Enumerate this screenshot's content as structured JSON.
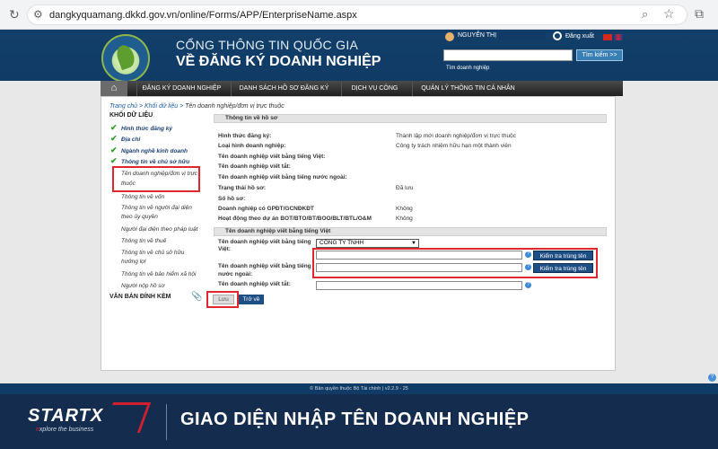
{
  "browser": {
    "url": "dangkyquamang.dkkd.gov.vn/online/Forms/APP/EnterpriseName.aspx"
  },
  "header": {
    "title_line1": "CỔNG THÔNG TIN QUỐC GIA",
    "title_line2": "VỀ ĐĂNG KÝ DOANH NGHIỆP",
    "user_name": "NGUYỄN THỊ",
    "logout_label": "Đăng xuất",
    "search_button": "Tìm kiếm >>",
    "search_hint": "Tìm doanh nghiệp"
  },
  "nav": {
    "items": [
      "ĐĂNG KÝ DOANH NGHIỆP",
      "DANH SÁCH HỒ SƠ ĐĂNG KÝ",
      "DỊCH VỤ CÔNG",
      "QUẢN LÝ THÔNG TIN CÁ NHÂN"
    ]
  },
  "breadcrumb": {
    "home": "Trang chủ",
    "section": "Khối dữ liệu",
    "current": "Tên doanh nghiệp/đơn vị trực thuộc"
  },
  "sidebar": {
    "title": "KHỐI DỮ LIỆU",
    "checked_items": [
      "Hình thức đăng ký",
      "Địa chỉ",
      "Ngành nghề kinh doanh",
      "Thông tin về chủ sở hữu"
    ],
    "active_item_line1": "Tên doanh nghiệp/đơn vị trực",
    "active_item_line2": "thuộc",
    "items": [
      "Thông tin về vốn",
      "Thông tin về người đại diện theo ủy quyền",
      "Người đại diện theo pháp luật",
      "Thông tin về thuế",
      "Thông tin về chủ sở hữu hưởng lợi",
      "Thông tin về bảo hiểm xã hội",
      "Người nộp hồ sơ"
    ],
    "attachments": "VĂN BẢN ĐÍNH KÈM"
  },
  "profile": {
    "header": "Thông tin về hồ sơ",
    "rows": [
      {
        "label": "Hình thức đăng ký:",
        "value": "Thành lập mới doanh nghiệp/đơn vị trực thuộc"
      },
      {
        "label": "Loại hình doanh nghiệp:",
        "value": "Công ty trách nhiệm hữu hạn một thành viên"
      },
      {
        "label": "Tên doanh nghiệp viết bằng tiếng Việt:",
        "value": ""
      },
      {
        "label": "Tên doanh nghiệp viết tắt:",
        "value": ""
      },
      {
        "label": "Tên doanh nghiệp viết bằng tiếng nước ngoài:",
        "value": ""
      },
      {
        "label": "Trạng thái hồ sơ:",
        "value": "Đã lưu"
      },
      {
        "label": "Số hồ sơ:",
        "value": ""
      },
      {
        "label": "Doanh nghiệp có GPĐT/GCNĐKĐT",
        "value": "Không"
      },
      {
        "label": "Hoạt động theo dự án BOT/BTO/BT/BOO/BLT/BTL/O&M",
        "value": "Không"
      }
    ]
  },
  "name_form": {
    "header": "Tên doanh nghiệp viết bằng tiếng Việt",
    "vn_label_line1": "Tên doanh nghiệp viết bằng tiếng",
    "vn_label_line2": "Việt:",
    "vn_select": "CÔNG TY TNHH",
    "vn_value": "",
    "foreign_label_line1": "Tên doanh nghiệp viết bằng tiếng",
    "foreign_label_line2": "nước ngoài:",
    "foreign_value": "",
    "abbr_label": "Tên doanh nghiệp viết tắt:",
    "abbr_value": "",
    "check_button": "Kiểm tra trùng tên",
    "help": "?"
  },
  "actions": {
    "save": "Lưu",
    "back": "Trở về"
  },
  "footer": {
    "text": "© Bản quyền thuộc Bộ Tài chính | v2.2.9 - 25"
  },
  "banner": {
    "brand": "START",
    "brand_x": "X",
    "tagline_prefix": "e",
    "tagline_rest": "xplore the business",
    "title": "GIAO DIỆN NHẬP TÊN DOANH NGHIỆP"
  },
  "colors": {
    "header_blue": "#0f3b66",
    "highlight_red": "#e0272d",
    "button_blue": "#1e4f84",
    "check_green": "#2a9d2a"
  }
}
